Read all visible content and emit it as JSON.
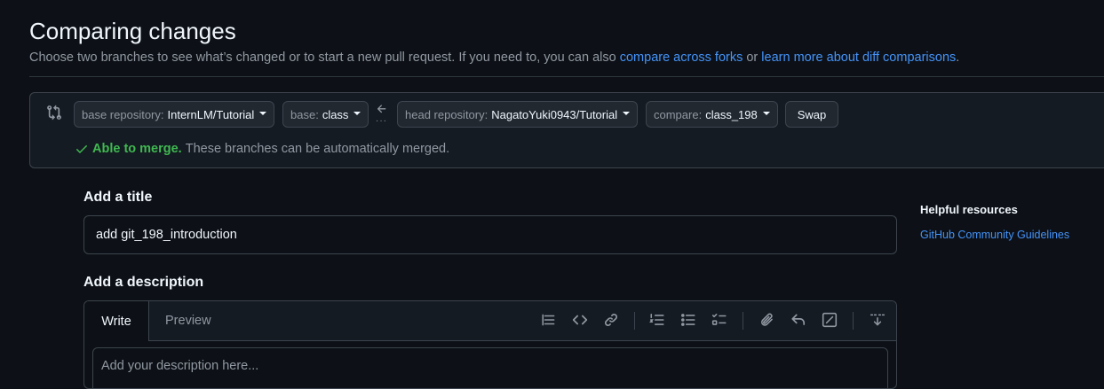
{
  "page": {
    "title": "Comparing changes",
    "subtitle_prefix": "Choose two branches to see what’s changed or to start a new pull request. If you need to, you can also ",
    "subtitle_link1": "compare across forks",
    "subtitle_mid": " or ",
    "subtitle_link2": "learn more about diff comparisons",
    "subtitle_suffix": "."
  },
  "range": {
    "base_repo_label": "base repository:",
    "base_repo_value": "InternLM/Tutorial",
    "base_label": "base:",
    "base_value": "class",
    "head_repo_label": "head repository:",
    "head_repo_value": "NagatoYuki0943/Tutorial",
    "compare_label": "compare:",
    "compare_value": "class_198",
    "swap_label": "Swap",
    "merge_status": "Able to merge.",
    "merge_message": "These branches can be automatically merged."
  },
  "form": {
    "title_label": "Add a title",
    "title_value": "add git_198_introduction",
    "description_label": "Add a description",
    "tab_write": "Write",
    "tab_preview": "Preview",
    "description_placeholder": "Add your description here..."
  },
  "sidebar": {
    "heading": "Helpful resources",
    "link": "GitHub Community Guidelines"
  },
  "colors": {
    "background": "#0d1117",
    "link": "#4493f8",
    "success": "#3fb950",
    "border": "#3d444d"
  }
}
